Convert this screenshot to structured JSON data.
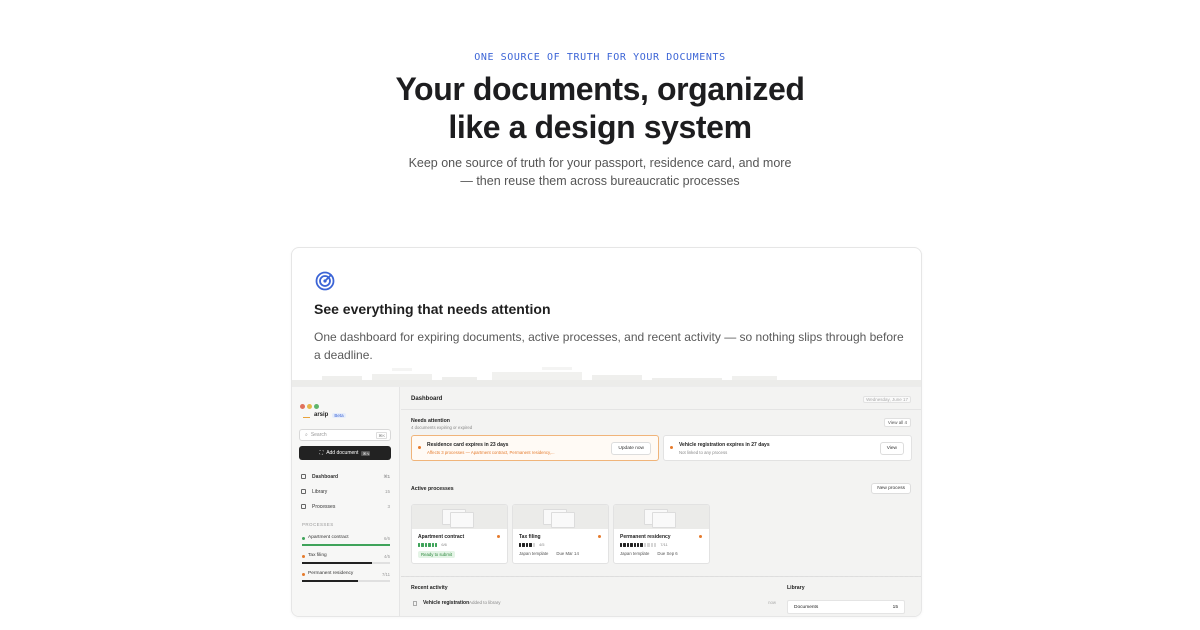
{
  "hero": {
    "eyebrow": "ONE SOURCE OF TRUTH FOR YOUR DOCUMENTS",
    "headline_line1": "Your documents, organized",
    "headline_line2": "like a design system",
    "subhead_line1": "Keep one source of truth for your passport, residence card, and more",
    "subhead_line2": "— then reuse them across bureaucratic processes"
  },
  "feature": {
    "icon": "radar-icon",
    "title": "See everything that needs attention",
    "description": "One dashboard for expiring documents, active processes, and recent activity — so nothing slips through before a deadline."
  },
  "app": {
    "window_dots": [
      "#e0725c",
      "#e6b84a",
      "#5fb56b"
    ],
    "brand": {
      "name": "arsip",
      "badge": "Beta"
    },
    "search": {
      "placeholder": "Search",
      "shortcut": "⌘K"
    },
    "add_button": {
      "label": "Add document",
      "shortcut": "⌘N"
    },
    "nav": [
      {
        "label": "Dashboard",
        "count": "⌘1",
        "active": true
      },
      {
        "label": "Library",
        "count": "15"
      },
      {
        "label": "Processes",
        "count": "3"
      }
    ],
    "processes_label": "PROCESSES",
    "processes": [
      {
        "label": "Apartment contract",
        "count": "6/6",
        "color": "#3fa35a",
        "progress": 1.0
      },
      {
        "label": "Tax filing",
        "count": "4/5",
        "color": "#e57b2c",
        "progress": 0.8
      },
      {
        "label": "Permanent residency",
        "count": "7/11",
        "color": "#e57b2c",
        "progress": 0.64
      }
    ],
    "main": {
      "title": "Dashboard",
      "date": "Wednesday, June 17",
      "needs_attention": {
        "title": "Needs attention",
        "subtitle": "4 documents expiring or expired",
        "view_all": "View all 4",
        "alerts": [
          {
            "title": "Residence card expires in 23 days",
            "subtitle": "Affects 3 processes — Apartment contract, Permanent residency,...",
            "button": "Update now"
          },
          {
            "title": "Vehicle registration expires in 27 days",
            "subtitle": "Not linked to any process",
            "button": "View"
          }
        ]
      },
      "active_processes": {
        "title": "Active processes",
        "new_button": "New process",
        "cards": [
          {
            "title": "Apartment contract",
            "progress_text": "6/6",
            "done": 6,
            "total": 6,
            "tag": "Ready to submit",
            "ready": true
          },
          {
            "title": "Tax filing",
            "progress_text": "4/5",
            "done": 4,
            "total": 5,
            "tag": "Japan template",
            "due": "Due Mar 14"
          },
          {
            "title": "Permanent residency",
            "progress_text": "7/11",
            "done": 7,
            "total": 11,
            "tag": "Japan template",
            "due": "Due Sep 6"
          }
        ]
      },
      "recent_activity": {
        "title": "Recent activity",
        "rows": [
          {
            "name": "Vehicle registration",
            "action": "Added to library",
            "time": "now"
          }
        ]
      },
      "library": {
        "title": "Library",
        "rows": [
          {
            "label": "Documents",
            "count": "15"
          }
        ]
      }
    }
  }
}
